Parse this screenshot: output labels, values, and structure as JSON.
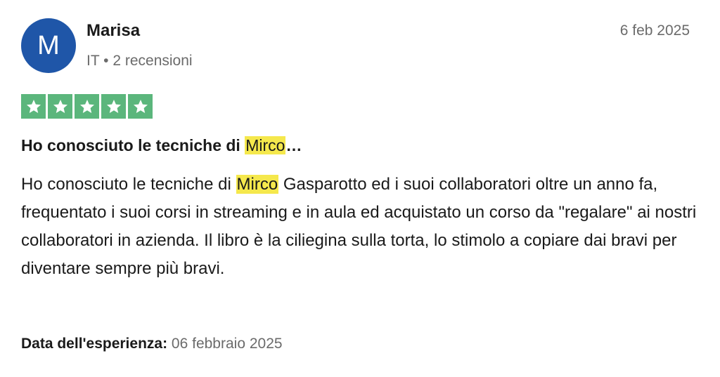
{
  "reviewer": {
    "avatar_initial": "M",
    "avatar_color": "#1f56a8",
    "name": "Marisa",
    "country": "IT",
    "separator": "•",
    "reviews_count": "2 recensioni"
  },
  "review": {
    "date": "6 feb 2025",
    "rating": 5,
    "rating_max": 5,
    "star_color": "#5bb67c",
    "title_before": "Ho conosciuto le tecniche di ",
    "title_highlight": "Mirco",
    "title_after": "…",
    "body_before": "Ho conosciuto le tecniche di ",
    "body_highlight": "Mirco",
    "body_after": " Gasparotto ed i suoi collaboratori oltre un anno fa, frequentato i suoi corsi in streaming e in aula ed acquistato un corso da \"regalare\" ai nostri collaboratori in azienda. Il libro è la ciliegina sulla torta, lo stimolo a copiare dai bravi per diventare sempre più bravi.",
    "highlight_color": "#f5e84c",
    "experience_label": "Data dell'esperienza:",
    "experience_date": "06 febbraio 2025"
  }
}
